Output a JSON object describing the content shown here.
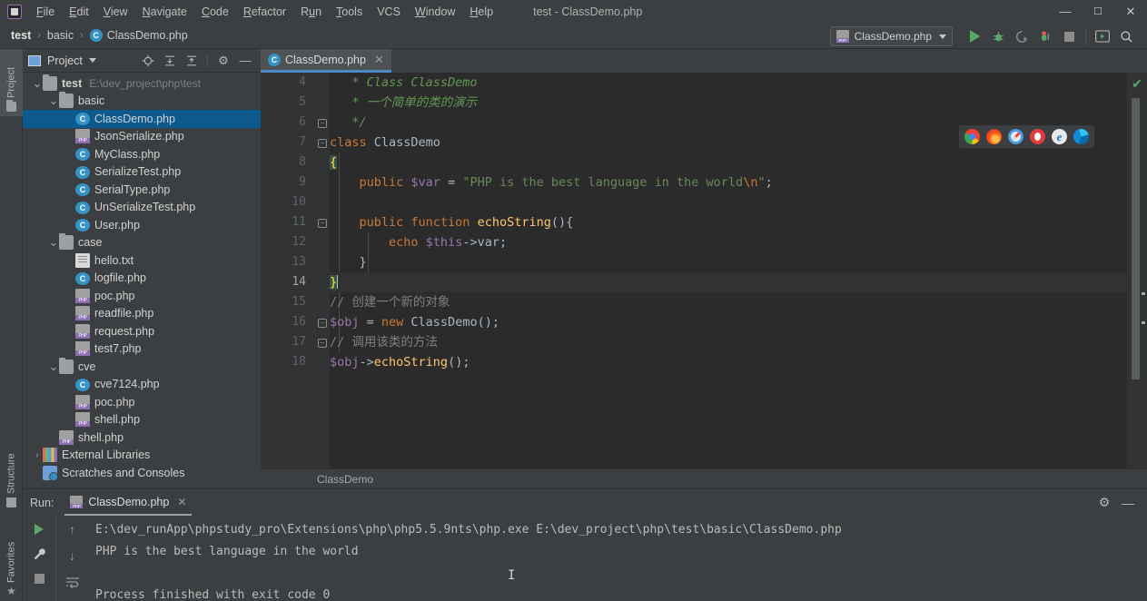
{
  "window": {
    "title": "test - ClassDemo.php",
    "logo_icon": "phpstorm-logo-icon",
    "controls": [
      {
        "name": "minimize-button",
        "glyph": "—"
      },
      {
        "name": "maximize-button",
        "glyph": "❐"
      },
      {
        "name": "close-button",
        "glyph": "✕"
      }
    ]
  },
  "menubar": {
    "items": [
      {
        "label": "File"
      },
      {
        "label": "Edit"
      },
      {
        "label": "View"
      },
      {
        "label": "Navigate"
      },
      {
        "label": "Code"
      },
      {
        "label": "Refactor"
      },
      {
        "label": "Run"
      },
      {
        "label": "Tools"
      },
      {
        "label": "VCS"
      },
      {
        "label": "Window"
      },
      {
        "label": "Help"
      }
    ]
  },
  "breadcrumb": {
    "items": [
      "test",
      "basic",
      "ClassDemo.php"
    ],
    "separator": "›",
    "file_icon": "class-icon",
    "file_icon_letter": "C"
  },
  "run_config": {
    "name": "ClassDemo.php",
    "icon": "php-file-icon",
    "dropdown_icon": "chevron-down-icon"
  },
  "main_toolbar": {
    "buttons": [
      {
        "name": "run-button",
        "icon": "play-icon"
      },
      {
        "name": "debug-button",
        "icon": "bug-icon"
      },
      {
        "name": "run-with-coverage-button",
        "icon": "coverage-icon"
      },
      {
        "name": "profile-button",
        "icon": "profiler-icon"
      },
      {
        "name": "stop-button",
        "icon": "stop-icon"
      },
      {
        "name": "open-in-browser-button",
        "icon": "browser-icon"
      },
      {
        "name": "search-everywhere-button",
        "icon": "search-icon"
      }
    ]
  },
  "left_strip": {
    "tabs": [
      {
        "label": "Project",
        "icon": "project-folder-icon",
        "active": true
      },
      {
        "label": "Structure",
        "icon": "structure-icon",
        "active": false
      },
      {
        "label": "Favorites",
        "icon": "star-icon",
        "active": false
      }
    ]
  },
  "project_pane": {
    "title": "Project",
    "title_icon": "project-view-icon",
    "dropdown_icon": "chevron-down-icon",
    "tools": [
      {
        "name": "select-opened-file-button",
        "icon": "locate-icon",
        "glyph": "⊕"
      },
      {
        "name": "expand-all-button",
        "icon": "expand-all-icon",
        "glyph": "⤓"
      },
      {
        "name": "collapse-all-button",
        "icon": "collapse-all-icon",
        "glyph": "⤒"
      },
      {
        "name": "settings-button",
        "icon": "gear-icon",
        "glyph": "⚙"
      },
      {
        "name": "hide-button",
        "icon": "minimize-icon",
        "glyph": "—"
      }
    ],
    "tree": [
      {
        "label": "test",
        "path": "E:\\dev_project\\php\\test",
        "icon": "folder-icon",
        "indent": 0,
        "arrow": "expanded",
        "bold": true,
        "selected": false
      },
      {
        "label": "basic",
        "path": "",
        "icon": "folder-icon",
        "indent": 1,
        "arrow": "expanded",
        "bold": false,
        "selected": false
      },
      {
        "label": "ClassDemo.php",
        "path": "",
        "icon": "class-icon",
        "indent": 2,
        "arrow": "none",
        "bold": false,
        "selected": true
      },
      {
        "label": "JsonSerialize.php",
        "path": "",
        "icon": "php-icon",
        "indent": 2,
        "arrow": "none",
        "bold": false,
        "selected": false
      },
      {
        "label": "MyClass.php",
        "path": "",
        "icon": "class-icon",
        "indent": 2,
        "arrow": "none",
        "bold": false,
        "selected": false
      },
      {
        "label": "SerializeTest.php",
        "path": "",
        "icon": "class-icon",
        "indent": 2,
        "arrow": "none",
        "bold": false,
        "selected": false
      },
      {
        "label": "SerialType.php",
        "path": "",
        "icon": "class-icon",
        "indent": 2,
        "arrow": "none",
        "bold": false,
        "selected": false
      },
      {
        "label": "UnSerializeTest.php",
        "path": "",
        "icon": "class-icon",
        "indent": 2,
        "arrow": "none",
        "bold": false,
        "selected": false
      },
      {
        "label": "User.php",
        "path": "",
        "icon": "class-icon",
        "indent": 2,
        "arrow": "none",
        "bold": false,
        "selected": false
      },
      {
        "label": "case",
        "path": "",
        "icon": "folder-icon",
        "indent": 1,
        "arrow": "expanded",
        "bold": false,
        "selected": false
      },
      {
        "label": "hello.txt",
        "path": "",
        "icon": "text-icon",
        "indent": 2,
        "arrow": "none",
        "bold": false,
        "selected": false
      },
      {
        "label": "logfile.php",
        "path": "",
        "icon": "class-icon",
        "indent": 2,
        "arrow": "none",
        "bold": false,
        "selected": false
      },
      {
        "label": "poc.php",
        "path": "",
        "icon": "php-icon",
        "indent": 2,
        "arrow": "none",
        "bold": false,
        "selected": false
      },
      {
        "label": "readfile.php",
        "path": "",
        "icon": "php-icon",
        "indent": 2,
        "arrow": "none",
        "bold": false,
        "selected": false
      },
      {
        "label": "request.php",
        "path": "",
        "icon": "php-icon",
        "indent": 2,
        "arrow": "none",
        "bold": false,
        "selected": false
      },
      {
        "label": "test7.php",
        "path": "",
        "icon": "php-icon",
        "indent": 2,
        "arrow": "none",
        "bold": false,
        "selected": false
      },
      {
        "label": "cve",
        "path": "",
        "icon": "folder-icon",
        "indent": 1,
        "arrow": "expanded",
        "bold": false,
        "selected": false
      },
      {
        "label": "cve7124.php",
        "path": "",
        "icon": "class-icon",
        "indent": 2,
        "arrow": "none",
        "bold": false,
        "selected": false
      },
      {
        "label": "poc.php",
        "path": "",
        "icon": "php-icon",
        "indent": 2,
        "arrow": "none",
        "bold": false,
        "selected": false
      },
      {
        "label": "shell.php",
        "path": "",
        "icon": "php-icon",
        "indent": 2,
        "arrow": "none",
        "bold": false,
        "selected": false
      },
      {
        "label": "shell.php",
        "path": "",
        "icon": "php-icon",
        "indent": 1,
        "arrow": "none",
        "bold": false,
        "selected": false
      },
      {
        "label": "External Libraries",
        "path": "",
        "icon": "library-icon",
        "indent": 0,
        "arrow": "collapsed",
        "bold": false,
        "selected": false
      },
      {
        "label": "Scratches and Consoles",
        "path": "",
        "icon": "scratch-icon",
        "indent": 0,
        "arrow": "none",
        "bold": false,
        "selected": false
      }
    ]
  },
  "editor": {
    "tab": {
      "label": "ClassDemo.php",
      "icon": "class-icon",
      "close_icon": "close-icon"
    },
    "first_line_number": 4,
    "current_line": 14,
    "status_breadcrumb": "ClassDemo",
    "inspection_status_icon": "check-ok-icon",
    "lines": [
      {
        "n": 4,
        "tokens": [
          {
            "t": "   * Class ClassDemo",
            "c": "cmt"
          }
        ]
      },
      {
        "n": 5,
        "tokens": [
          {
            "t": "   * 一个简单的类的演示",
            "c": "cmt"
          }
        ]
      },
      {
        "n": 6,
        "tokens": [
          {
            "t": "   */",
            "c": "cmt"
          }
        ]
      },
      {
        "n": 7,
        "tokens": [
          {
            "t": "class ",
            "c": "kw"
          },
          {
            "t": "ClassDemo",
            "c": "plain"
          }
        ]
      },
      {
        "n": 8,
        "tokens": [
          {
            "t": "{",
            "c": "brace-hl"
          }
        ]
      },
      {
        "n": 9,
        "tokens": [
          {
            "t": "    ",
            "c": "plain"
          },
          {
            "t": "public ",
            "c": "kw"
          },
          {
            "t": "$var ",
            "c": "var"
          },
          {
            "t": "= ",
            "c": "plain"
          },
          {
            "t": "\"PHP is the best language in the world",
            "c": "str"
          },
          {
            "t": "\\n",
            "c": "esc"
          },
          {
            "t": "\"",
            "c": "str"
          },
          {
            "t": ";",
            "c": "plain"
          }
        ]
      },
      {
        "n": 10,
        "tokens": [
          {
            "t": "",
            "c": "plain"
          }
        ]
      },
      {
        "n": 11,
        "tokens": [
          {
            "t": "    ",
            "c": "plain"
          },
          {
            "t": "public function ",
            "c": "kw"
          },
          {
            "t": "echoString",
            "c": "fn"
          },
          {
            "t": "(){",
            "c": "plain"
          }
        ]
      },
      {
        "n": 12,
        "tokens": [
          {
            "t": "        ",
            "c": "plain"
          },
          {
            "t": "echo ",
            "c": "kw"
          },
          {
            "t": "$this",
            "c": "var"
          },
          {
            "t": "->var;",
            "c": "plain"
          }
        ]
      },
      {
        "n": 13,
        "tokens": [
          {
            "t": "    }",
            "c": "plain"
          }
        ]
      },
      {
        "n": 14,
        "tokens": [
          {
            "t": "}",
            "c": "brace-hl"
          }
        ]
      },
      {
        "n": 15,
        "tokens": [
          {
            "t": "// 创建一个新的对象",
            "c": "cmt2"
          }
        ]
      },
      {
        "n": 16,
        "tokens": [
          {
            "t": "$obj ",
            "c": "var"
          },
          {
            "t": "= ",
            "c": "plain"
          },
          {
            "t": "new ",
            "c": "kw"
          },
          {
            "t": "ClassDemo();",
            "c": "plain"
          }
        ]
      },
      {
        "n": 17,
        "tokens": [
          {
            "t": "// 调用该类的方法",
            "c": "cmt2"
          }
        ]
      },
      {
        "n": 18,
        "tokens": [
          {
            "t": "$obj",
            "c": "var"
          },
          {
            "t": "->",
            "c": "plain"
          },
          {
            "t": "echoString",
            "c": "fn"
          },
          {
            "t": "();",
            "c": "plain"
          }
        ]
      }
    ]
  },
  "browser_popup": {
    "browsers": [
      {
        "name": "chrome-icon",
        "label": "Chrome"
      },
      {
        "name": "firefox-icon",
        "label": "Firefox"
      },
      {
        "name": "safari-icon",
        "label": "Safari"
      },
      {
        "name": "opera-icon",
        "label": "Opera"
      },
      {
        "name": "internet-explorer-icon",
        "label": "Internet Explorer",
        "glyph": "e"
      },
      {
        "name": "edge-icon",
        "label": "Edge"
      }
    ]
  },
  "run_panel": {
    "label": "Run:",
    "tab": {
      "label": "ClassDemo.php",
      "icon": "php-file-icon",
      "close_icon": "close-icon"
    },
    "header_tools": [
      {
        "name": "settings-button",
        "icon": "gear-icon",
        "glyph": "⚙"
      },
      {
        "name": "hide-button",
        "icon": "minimize-icon",
        "glyph": "—"
      }
    ],
    "left_tools": [
      {
        "name": "rerun-button",
        "icon": "play-icon"
      },
      {
        "name": "edit-configuration-button",
        "icon": "wrench-icon",
        "glyph": "🔧"
      },
      {
        "name": "stop-button",
        "icon": "stop-icon"
      }
    ],
    "right_tools": [
      {
        "name": "up-stack-trace-button",
        "icon": "arrow-up-icon",
        "glyph": "↑"
      },
      {
        "name": "down-stack-trace-button",
        "icon": "arrow-down-icon",
        "glyph": "↓"
      },
      {
        "name": "soft-wrap-button",
        "icon": "soft-wrap-icon"
      }
    ],
    "console_lines": [
      "E:\\dev_runApp\\phpstudy_pro\\Extensions\\php\\php5.5.9nts\\php.exe E:\\dev_project\\php\\test\\basic\\ClassDemo.php",
      "PHP is the best language in the world",
      "",
      "Process finished with exit code 0"
    ]
  },
  "colors": {
    "background": "#3c3f41",
    "editor_background": "#2b2b2b",
    "gutter": "#313335",
    "selection": "#0d5a8f",
    "accent": "#4a88c7",
    "run_green": "#59a869",
    "comment_green": "#629755",
    "keyword_orange": "#cc7832",
    "string_green": "#6a8759",
    "variable_purple": "#9876aa",
    "function_yellow": "#ffc66d",
    "brace_highlight": "#3b514d"
  }
}
